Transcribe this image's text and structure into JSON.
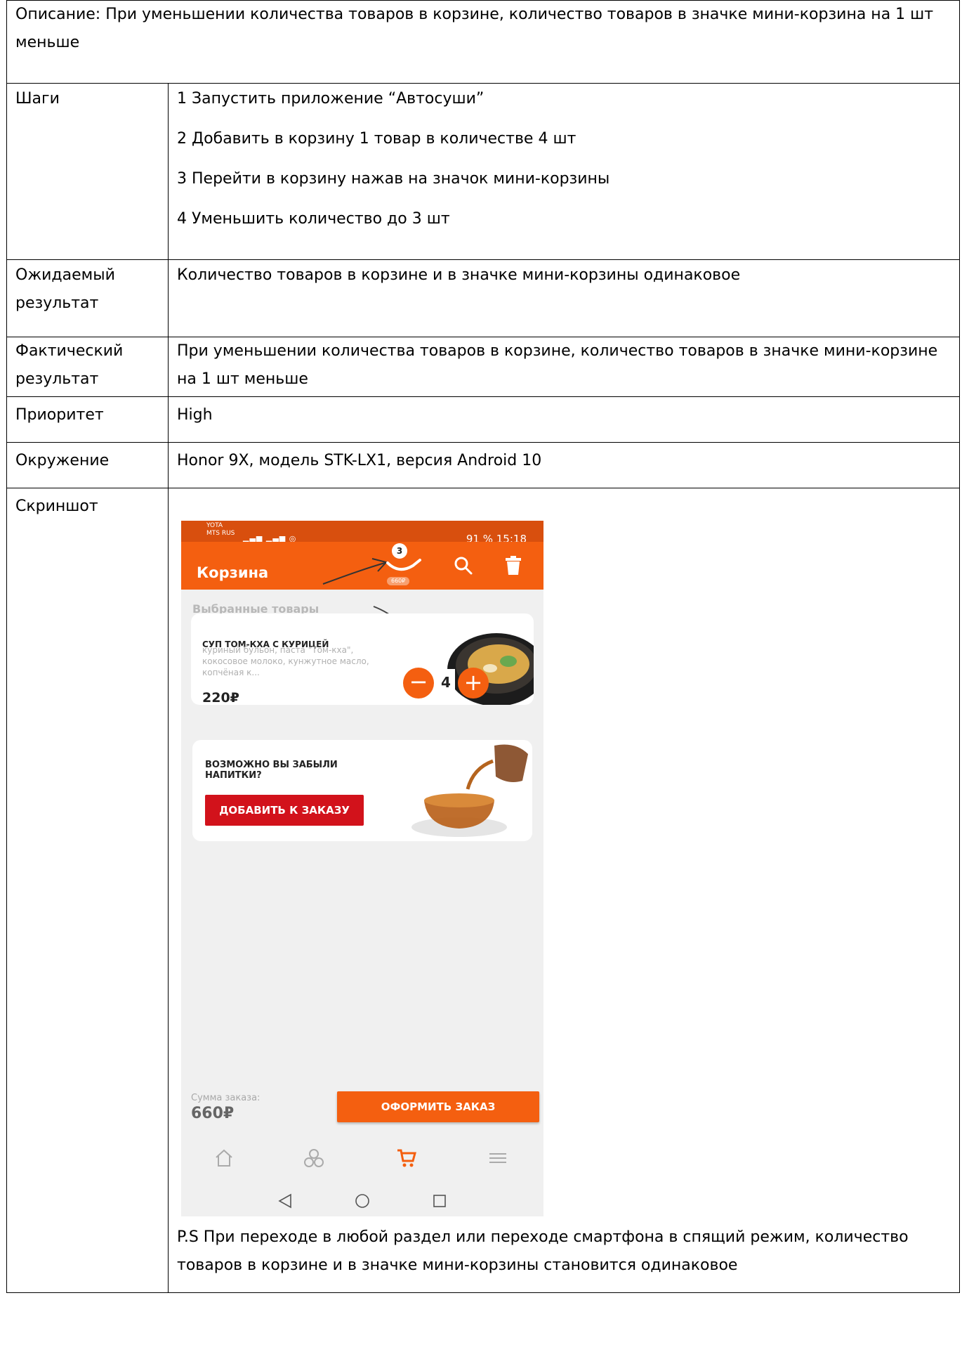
{
  "description": "Описание: При уменьшении количества товаров в корзине, количество товаров в значке мини-корзина на 1 шт меньше",
  "rows": {
    "steps": {
      "label": "Шаги",
      "items": [
        "1 Запустить приложение “Автосуши”",
        "2 Добавить в корзину 1 товар в количестве 4 шт",
        "3 Перейти в корзину нажав на значок мини-корзины",
        "4 Уменьшить количество до 3 шт"
      ]
    },
    "expected": {
      "label": "Ожидаемый результат",
      "value": "Количество товаров в корзине и в значке мини-корзины одинаковое"
    },
    "actual": {
      "label": "Фактический результат",
      "value": "При уменьшении количества товаров в корзине, количество товаров в значке мини-корзине на 1 шт меньше"
    },
    "priority": {
      "label": "Приоритет",
      "value": "High"
    },
    "environment": {
      "label": "Окружение",
      "value": "Honor 9X, модель STK-LX1, версия Android 10"
    },
    "screenshot": {
      "label": "Скриншот",
      "note": "P.S При переходе в любой раздел или переходе смартфона в спящий режим, количество товаров в корзине и в значке мини-корзины становится одинаковое"
    }
  },
  "phone": {
    "status": {
      "operator1": "YOTA",
      "operator2": "MTS RUS",
      "right": "91 %  15:18"
    },
    "appbar": {
      "title": "Корзина",
      "cart_count": "3",
      "cart_sum": "660₽"
    },
    "section_label": "Выбранные товары",
    "item": {
      "title": "СУП ТОМ-КХА С КУРИЦЕЙ",
      "description": "куриный бульон, паста \"Том-кха\", кокосовое молоко, кунжутное масло, копчёная к...",
      "price": "220₽",
      "minus": "−",
      "quantity": "4",
      "plus": "+"
    },
    "promo": {
      "text": "ВОЗМОЖНО ВЫ ЗАБЫЛИ НАПИТКИ?",
      "button": "ДОБАВИТЬ К ЗАКАЗУ"
    },
    "checkout": {
      "sum_label": "Сумма заказа:",
      "sum_value": "660₽",
      "button": "ОФОРМИТЬ ЗАКАЗ"
    },
    "colors": {
      "accent": "#f45f10",
      "statusbar": "#d84f0e",
      "promo_button": "#d2121b",
      "background": "#f0f0f0"
    },
    "icons": [
      "cart-bowl-icon",
      "search-icon",
      "trash-icon",
      "home-icon",
      "sushi-icon",
      "cart-icon",
      "menu-icon",
      "back-icon",
      "home-circle-icon",
      "recents-icon"
    ]
  }
}
